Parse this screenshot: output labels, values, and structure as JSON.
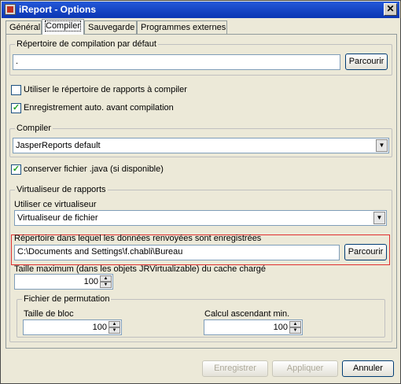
{
  "window": {
    "title": "iReport - Options",
    "close": "✕"
  },
  "tabs": [
    {
      "label": "Général",
      "active": false
    },
    {
      "label": "Compiler",
      "active": true
    },
    {
      "label": "Sauvegarde",
      "active": false
    },
    {
      "label": "Programmes externes",
      "active": false
    }
  ],
  "compile_dir": {
    "legend": "Répertoire de compilation par défaut",
    "value": ".",
    "browse": "Parcourir"
  },
  "options": {
    "use_reports_dir": {
      "label": "Utiliser le répertoire de rapports à compiler",
      "checked": false
    },
    "auto_save": {
      "label": "Enregistrement auto. avant compilation",
      "checked": true,
      "mark": "✓"
    }
  },
  "compiler": {
    "legend": "Compiler",
    "selected": "JasperReports default"
  },
  "keep_java": {
    "label": "conserver fichier .java (si disponible)",
    "checked": true,
    "mark": "✓"
  },
  "virtualizer": {
    "legend": "Virtualiseur de rapports",
    "use_label": "Utiliser ce virtualiseur",
    "selected": "Virtualiseur de fichier",
    "dir_label": "Répertoire dans lequel les données renvoyées sont enregistrées",
    "dir_value": "C:\\Documents and Settings\\f.chabli\\Bureau",
    "dir_browse": "Parcourir",
    "max_size_label": "Taille maximum (dans les objets JRVirtualizable) du cache chargé",
    "max_size_value": "100",
    "swap": {
      "legend": "Fichier de permutation",
      "block_label": "Taille de bloc",
      "block_value": "100",
      "min_grow_label": "Calcul ascendant min.",
      "min_grow_value": "100"
    }
  },
  "footer": {
    "save": "Enregistrer",
    "apply": "Appliquer",
    "cancel": "Annuler"
  },
  "icons": {
    "dropdown": "▼",
    "spin_up": "▲",
    "spin_down": "▼"
  },
  "colors": {
    "titlebar": "#0a36b3",
    "highlight_box": "#e03030",
    "window_bg": "#ece9d8"
  }
}
